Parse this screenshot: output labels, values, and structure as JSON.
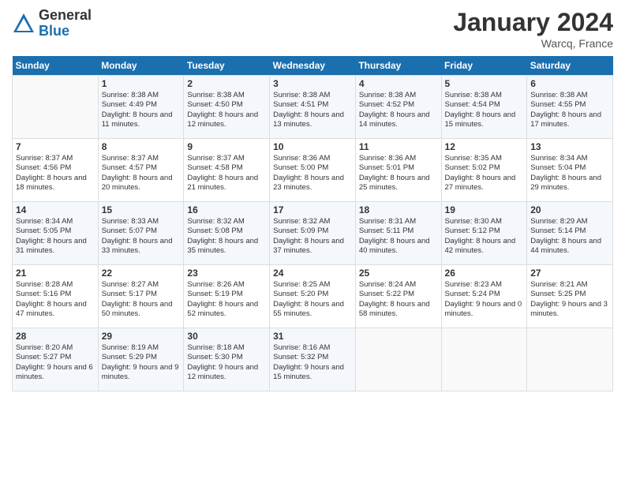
{
  "header": {
    "logo_general": "General",
    "logo_blue": "Blue",
    "title": "January 2024",
    "location": "Warcq, France"
  },
  "days_of_week": [
    "Sunday",
    "Monday",
    "Tuesday",
    "Wednesday",
    "Thursday",
    "Friday",
    "Saturday"
  ],
  "weeks": [
    [
      {
        "day": "",
        "sunrise": "",
        "sunset": "",
        "daylight": "",
        "empty": true
      },
      {
        "day": "1",
        "sunrise": "Sunrise: 8:38 AM",
        "sunset": "Sunset: 4:49 PM",
        "daylight": "Daylight: 8 hours and 11 minutes."
      },
      {
        "day": "2",
        "sunrise": "Sunrise: 8:38 AM",
        "sunset": "Sunset: 4:50 PM",
        "daylight": "Daylight: 8 hours and 12 minutes."
      },
      {
        "day": "3",
        "sunrise": "Sunrise: 8:38 AM",
        "sunset": "Sunset: 4:51 PM",
        "daylight": "Daylight: 8 hours and 13 minutes."
      },
      {
        "day": "4",
        "sunrise": "Sunrise: 8:38 AM",
        "sunset": "Sunset: 4:52 PM",
        "daylight": "Daylight: 8 hours and 14 minutes."
      },
      {
        "day": "5",
        "sunrise": "Sunrise: 8:38 AM",
        "sunset": "Sunset: 4:54 PM",
        "daylight": "Daylight: 8 hours and 15 minutes."
      },
      {
        "day": "6",
        "sunrise": "Sunrise: 8:38 AM",
        "sunset": "Sunset: 4:55 PM",
        "daylight": "Daylight: 8 hours and 17 minutes."
      }
    ],
    [
      {
        "day": "7",
        "sunrise": "Sunrise: 8:37 AM",
        "sunset": "Sunset: 4:56 PM",
        "daylight": "Daylight: 8 hours and 18 minutes."
      },
      {
        "day": "8",
        "sunrise": "Sunrise: 8:37 AM",
        "sunset": "Sunset: 4:57 PM",
        "daylight": "Daylight: 8 hours and 20 minutes."
      },
      {
        "day": "9",
        "sunrise": "Sunrise: 8:37 AM",
        "sunset": "Sunset: 4:58 PM",
        "daylight": "Daylight: 8 hours and 21 minutes."
      },
      {
        "day": "10",
        "sunrise": "Sunrise: 8:36 AM",
        "sunset": "Sunset: 5:00 PM",
        "daylight": "Daylight: 8 hours and 23 minutes."
      },
      {
        "day": "11",
        "sunrise": "Sunrise: 8:36 AM",
        "sunset": "Sunset: 5:01 PM",
        "daylight": "Daylight: 8 hours and 25 minutes."
      },
      {
        "day": "12",
        "sunrise": "Sunrise: 8:35 AM",
        "sunset": "Sunset: 5:02 PM",
        "daylight": "Daylight: 8 hours and 27 minutes."
      },
      {
        "day": "13",
        "sunrise": "Sunrise: 8:34 AM",
        "sunset": "Sunset: 5:04 PM",
        "daylight": "Daylight: 8 hours and 29 minutes."
      }
    ],
    [
      {
        "day": "14",
        "sunrise": "Sunrise: 8:34 AM",
        "sunset": "Sunset: 5:05 PM",
        "daylight": "Daylight: 8 hours and 31 minutes."
      },
      {
        "day": "15",
        "sunrise": "Sunrise: 8:33 AM",
        "sunset": "Sunset: 5:07 PM",
        "daylight": "Daylight: 8 hours and 33 minutes."
      },
      {
        "day": "16",
        "sunrise": "Sunrise: 8:32 AM",
        "sunset": "Sunset: 5:08 PM",
        "daylight": "Daylight: 8 hours and 35 minutes."
      },
      {
        "day": "17",
        "sunrise": "Sunrise: 8:32 AM",
        "sunset": "Sunset: 5:09 PM",
        "daylight": "Daylight: 8 hours and 37 minutes."
      },
      {
        "day": "18",
        "sunrise": "Sunrise: 8:31 AM",
        "sunset": "Sunset: 5:11 PM",
        "daylight": "Daylight: 8 hours and 40 minutes."
      },
      {
        "day": "19",
        "sunrise": "Sunrise: 8:30 AM",
        "sunset": "Sunset: 5:12 PM",
        "daylight": "Daylight: 8 hours and 42 minutes."
      },
      {
        "day": "20",
        "sunrise": "Sunrise: 8:29 AM",
        "sunset": "Sunset: 5:14 PM",
        "daylight": "Daylight: 8 hours and 44 minutes."
      }
    ],
    [
      {
        "day": "21",
        "sunrise": "Sunrise: 8:28 AM",
        "sunset": "Sunset: 5:16 PM",
        "daylight": "Daylight: 8 hours and 47 minutes."
      },
      {
        "day": "22",
        "sunrise": "Sunrise: 8:27 AM",
        "sunset": "Sunset: 5:17 PM",
        "daylight": "Daylight: 8 hours and 50 minutes."
      },
      {
        "day": "23",
        "sunrise": "Sunrise: 8:26 AM",
        "sunset": "Sunset: 5:19 PM",
        "daylight": "Daylight: 8 hours and 52 minutes."
      },
      {
        "day": "24",
        "sunrise": "Sunrise: 8:25 AM",
        "sunset": "Sunset: 5:20 PM",
        "daylight": "Daylight: 8 hours and 55 minutes."
      },
      {
        "day": "25",
        "sunrise": "Sunrise: 8:24 AM",
        "sunset": "Sunset: 5:22 PM",
        "daylight": "Daylight: 8 hours and 58 minutes."
      },
      {
        "day": "26",
        "sunrise": "Sunrise: 8:23 AM",
        "sunset": "Sunset: 5:24 PM",
        "daylight": "Daylight: 9 hours and 0 minutes."
      },
      {
        "day": "27",
        "sunrise": "Sunrise: 8:21 AM",
        "sunset": "Sunset: 5:25 PM",
        "daylight": "Daylight: 9 hours and 3 minutes."
      }
    ],
    [
      {
        "day": "28",
        "sunrise": "Sunrise: 8:20 AM",
        "sunset": "Sunset: 5:27 PM",
        "daylight": "Daylight: 9 hours and 6 minutes."
      },
      {
        "day": "29",
        "sunrise": "Sunrise: 8:19 AM",
        "sunset": "Sunset: 5:29 PM",
        "daylight": "Daylight: 9 hours and 9 minutes."
      },
      {
        "day": "30",
        "sunrise": "Sunrise: 8:18 AM",
        "sunset": "Sunset: 5:30 PM",
        "daylight": "Daylight: 9 hours and 12 minutes."
      },
      {
        "day": "31",
        "sunrise": "Sunrise: 8:16 AM",
        "sunset": "Sunset: 5:32 PM",
        "daylight": "Daylight: 9 hours and 15 minutes."
      },
      {
        "day": "",
        "sunrise": "",
        "sunset": "",
        "daylight": "",
        "empty": true
      },
      {
        "day": "",
        "sunrise": "",
        "sunset": "",
        "daylight": "",
        "empty": true
      },
      {
        "day": "",
        "sunrise": "",
        "sunset": "",
        "daylight": "",
        "empty": true
      }
    ]
  ]
}
